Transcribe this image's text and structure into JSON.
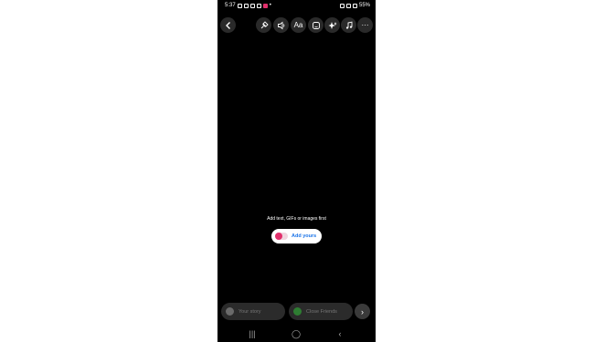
{
  "status_bar": {
    "time": "5:37",
    "battery": "55%"
  },
  "toolbar": {
    "back_icon": "chevron-left-icon",
    "tools": [
      {
        "name": "pin-icon"
      },
      {
        "name": "speaker-icon"
      },
      {
        "name": "text-tool",
        "label": "Aa"
      },
      {
        "name": "sticker-icon"
      },
      {
        "name": "effects-icon"
      },
      {
        "name": "music-icon"
      },
      {
        "name": "more-icon",
        "label": "···"
      }
    ]
  },
  "canvas": {
    "hint": "Add text, GIFs or images first",
    "sticker": {
      "label": "Add yours",
      "accent": "#e1306c",
      "label_color": "#1a73e8"
    }
  },
  "share_bar": {
    "your_story": "Your story",
    "close_friends": "Close Friends",
    "close_friends_color": "#2e7d32"
  },
  "nav_bar": {
    "recents": "|||",
    "home": "◯",
    "back": "‹"
  }
}
